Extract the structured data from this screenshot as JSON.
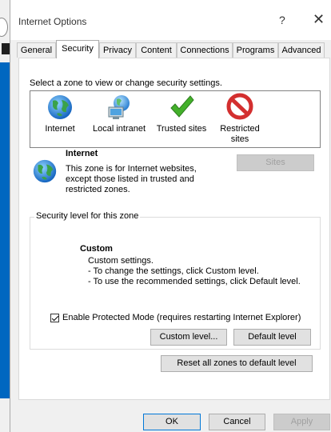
{
  "window": {
    "title": "Internet Options",
    "help_symbol": "?",
    "close_symbol": "✕"
  },
  "tabs": [
    {
      "label": "General"
    },
    {
      "label": "Security",
      "active": true
    },
    {
      "label": "Privacy"
    },
    {
      "label": "Content"
    },
    {
      "label": "Connections"
    },
    {
      "label": "Programs"
    },
    {
      "label": "Advanced"
    }
  ],
  "security": {
    "zone_prompt": "Select a zone to view or change security settings.",
    "zones": [
      {
        "label": "Internet",
        "icon": "globe-icon",
        "selected": true
      },
      {
        "label": "Local intranet",
        "icon": "intranet-icon"
      },
      {
        "label": "Trusted sites",
        "icon": "checkmark-icon"
      },
      {
        "label": "Restricted\nsites",
        "icon": "restricted-icon"
      }
    ],
    "selected_zone": {
      "name": "Internet",
      "description": "This zone is for Internet websites,\nexcept those listed in trusted and\nrestricted zones."
    },
    "sites_button": "Sites",
    "level_group_title": "Security level for this zone",
    "level": {
      "name": "Custom",
      "description": "Custom settings.\n- To change the settings, click Custom level.\n- To use the recommended settings, click Default level."
    },
    "protected_mode": {
      "label": "Enable Protected Mode (requires restarting Internet Explorer)",
      "checked": true
    },
    "custom_level_button": "Custom level...",
    "default_level_button": "Default level",
    "reset_all_button": "Reset all zones to default level"
  },
  "footer": {
    "ok": "OK",
    "cancel": "Cancel",
    "apply": "Apply"
  },
  "colors": {
    "accent": "#0078d7",
    "dialog_bg": "#f0f0f0",
    "panel_bg": "#ffffff"
  }
}
